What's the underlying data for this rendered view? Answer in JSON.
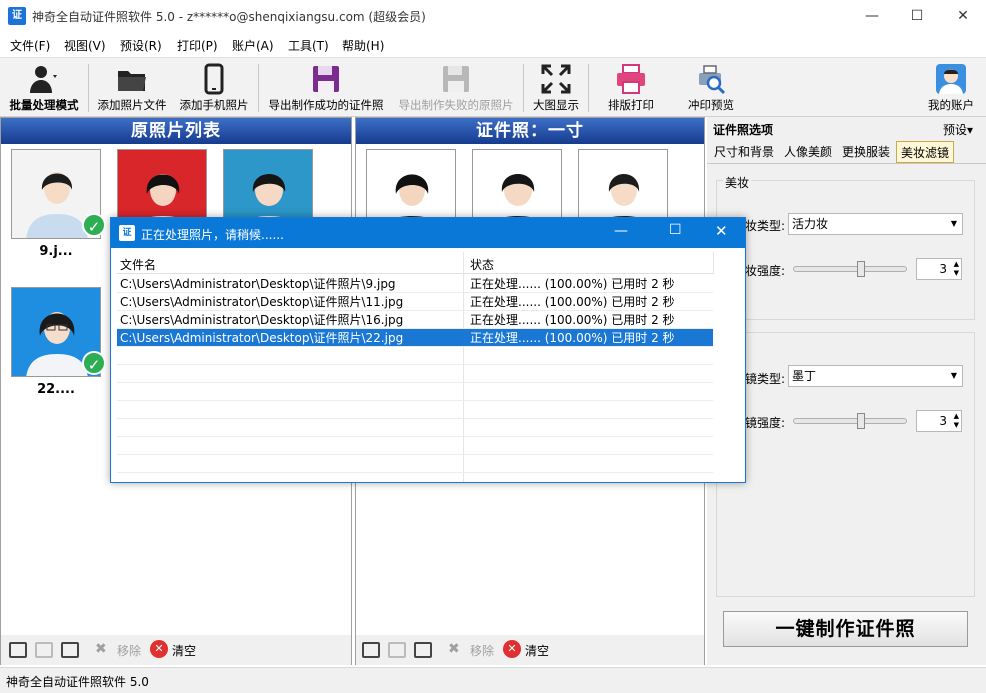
{
  "window": {
    "title": "神奇全自动证件照软件 5.0 - z******o@shenqixiangsu.com (超级会员)",
    "app_icon": "证"
  },
  "menu": [
    "文件(F)",
    "视图(V)",
    "预设(R)",
    "打印(P)",
    "账户(A)",
    "工具(T)",
    "帮助(H)"
  ],
  "toolbar": {
    "batch": "批量处理模式",
    "add_file": "添加照片文件",
    "add_phone": "添加手机照片",
    "export_ok": "导出制作成功的证件照",
    "export_fail": "导出制作失败的原照片",
    "big_view": "大图显示",
    "layout_print": "排版打印",
    "print_preview": "冲印预览",
    "my_account": "我的账户"
  },
  "left_panel": {
    "title": "原照片列表",
    "photos": [
      {
        "name": "9.j..."
      },
      {
        "name": "22...."
      }
    ]
  },
  "mid_panel": {
    "title": "证件照：一寸"
  },
  "bottom": {
    "remove": "移除",
    "clear": "清空"
  },
  "right_panel": {
    "title": "证件照选项",
    "preset": "预设▾",
    "tabs": [
      "尺寸和背景",
      "人像美颜",
      "更换服装",
      "美妆滤镜"
    ],
    "makeup_group": "美妆",
    "makeup_type_label": "妆类型:",
    "makeup_type_value": "活力妆",
    "makeup_strength_label": "妆强度:",
    "makeup_strength": "3",
    "filter_type_label": "镜类型:",
    "filter_type_value": "墨丁",
    "filter_strength_label": "镜强度:",
    "filter_strength": "3",
    "make_button": "一键制作证件照"
  },
  "dialog": {
    "title": "正在处理照片，请稍候......",
    "col_file": "文件名",
    "col_status": "状态",
    "rows": [
      {
        "file": "C:\\Users\\Administrator\\Desktop\\证件照片\\9.jpg",
        "status": "正在处理...... (100.00%) 已用时 2 秒"
      },
      {
        "file": "C:\\Users\\Administrator\\Desktop\\证件照片\\11.jpg",
        "status": "正在处理...... (100.00%) 已用时 2 秒"
      },
      {
        "file": "C:\\Users\\Administrator\\Desktop\\证件照片\\16.jpg",
        "status": "正在处理...... (100.00%) 已用时 2 秒"
      },
      {
        "file": "C:\\Users\\Administrator\\Desktop\\证件照片\\22.jpg",
        "status": "正在处理...... (100.00%) 已用时 2 秒"
      }
    ]
  },
  "statusbar": {
    "text": "神奇全自动证件照软件 5.0"
  },
  "colors": {
    "accent": "#0a78d7",
    "panel_header": "#1f4ea3",
    "check": "#2eae52"
  }
}
